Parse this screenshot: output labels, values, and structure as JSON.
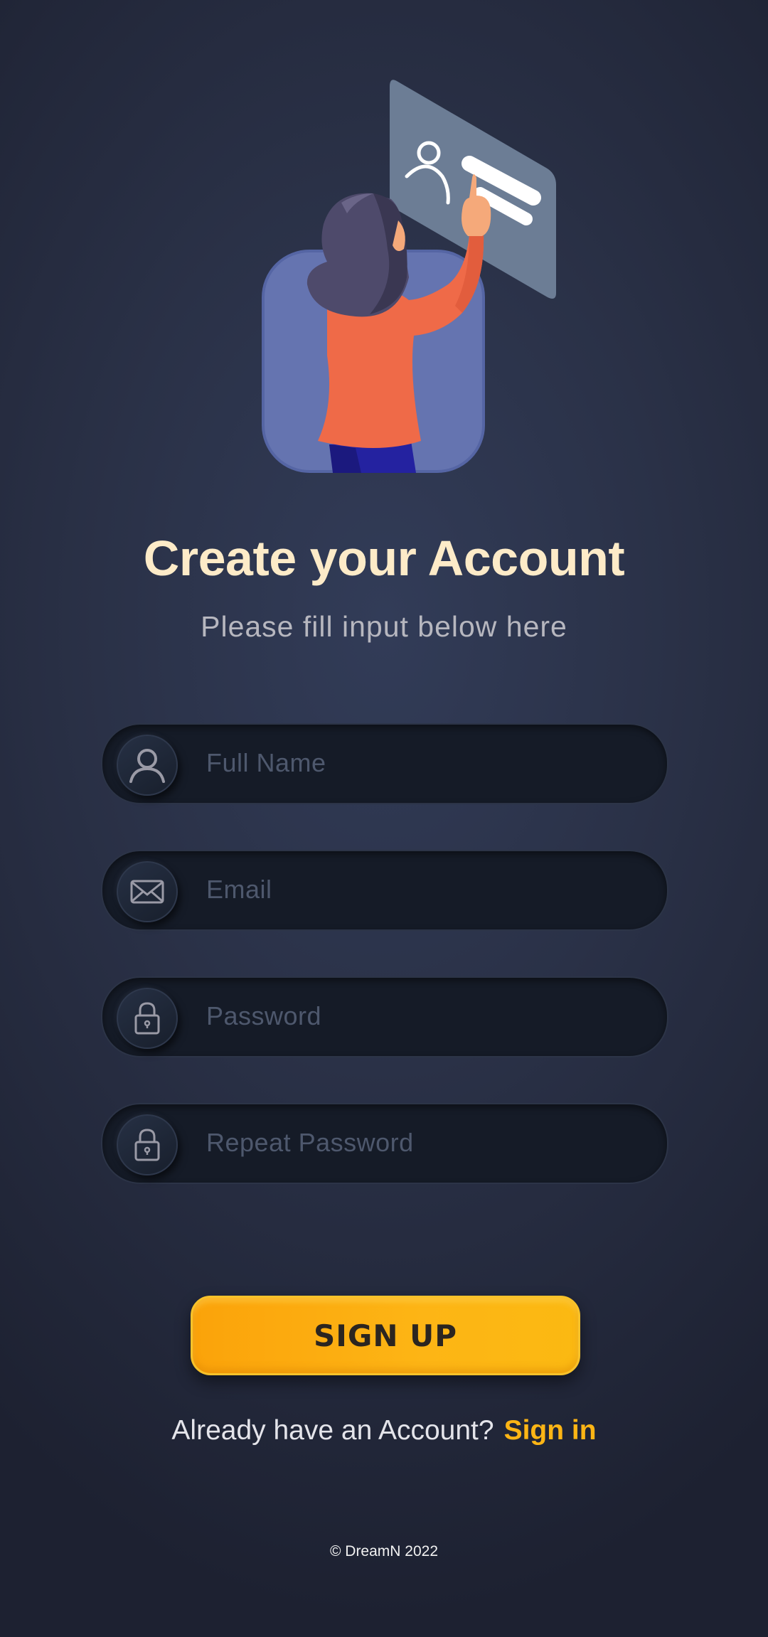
{
  "header": {
    "title": "Create your Account",
    "subtitle": "Please fill input below here"
  },
  "illustration": {
    "icon": "person-signing-form-illustration"
  },
  "form": {
    "fields": [
      {
        "icon": "user-icon",
        "placeholder": "Full Name",
        "value": ""
      },
      {
        "icon": "mail-icon",
        "placeholder": "Email",
        "value": ""
      },
      {
        "icon": "lock-icon",
        "placeholder": "Password",
        "value": ""
      },
      {
        "icon": "lock-icon",
        "placeholder": "Repeat Password",
        "value": ""
      }
    ],
    "submit_label": "SIGN UP"
  },
  "signin": {
    "prompt": "Already have an Account?",
    "link_label": "Sign in"
  },
  "footer": {
    "copyright": "© DreamN 2022"
  },
  "colors": {
    "accent": "#fdb515",
    "title": "#fdebc8",
    "background": "#2a3147"
  }
}
